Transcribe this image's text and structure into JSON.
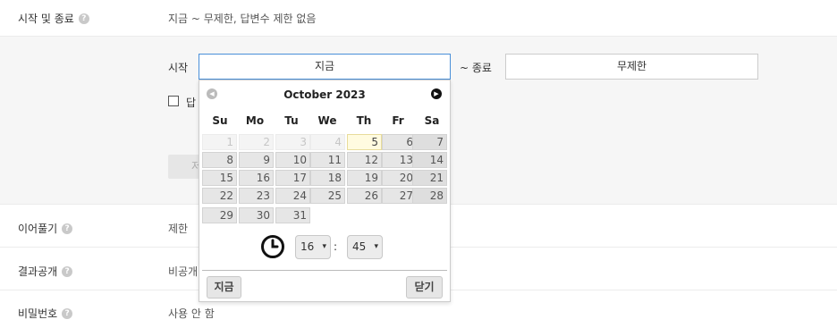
{
  "rows": {
    "start": {
      "label": "시작 및 종료",
      "value": "지금 ~ 무제한, 답변수 제한 없음"
    },
    "reply": {
      "label": "이어풀기",
      "value": "제한"
    },
    "result": {
      "label": "결과공개",
      "value": "비공개"
    },
    "password": {
      "label": "비밀번호",
      "value": "사용 안 함"
    }
  },
  "help_icon_glyph": "?",
  "form": {
    "start_label": "시작",
    "start_value": "지금",
    "tilde_label": "~ 종료",
    "end_value": "무제한",
    "checkbox_text": "답",
    "ghost_button": "저"
  },
  "calendar": {
    "title": "October 2023",
    "prev_icon": "◀",
    "next_icon": "▶",
    "weekdays": [
      "Su",
      "Mo",
      "Tu",
      "We",
      "Th",
      "Fr",
      "Sa"
    ],
    "weeks": [
      [
        "1",
        "2",
        "3",
        "4",
        "5",
        "6",
        "7"
      ],
      [
        "8",
        "9",
        "10",
        "11",
        "12",
        "13",
        "14"
      ],
      [
        "15",
        "16",
        "17",
        "18",
        "19",
        "20",
        "21"
      ],
      [
        "22",
        "23",
        "24",
        "25",
        "26",
        "27",
        "28"
      ],
      [
        "29",
        "30",
        "31",
        "",
        "",
        "",
        ""
      ]
    ],
    "disabled_days": [
      "1",
      "2",
      "3",
      "4"
    ],
    "today": "5",
    "hour": "16",
    "minute": "45",
    "colon": ":",
    "select_chevron": "▾",
    "now_button": "지금",
    "close_button": "닫기"
  },
  "colors": {
    "accent_border": "#4a90d9",
    "panel_bg": "#f6f6f6",
    "today_bg": "#fffbe0"
  }
}
